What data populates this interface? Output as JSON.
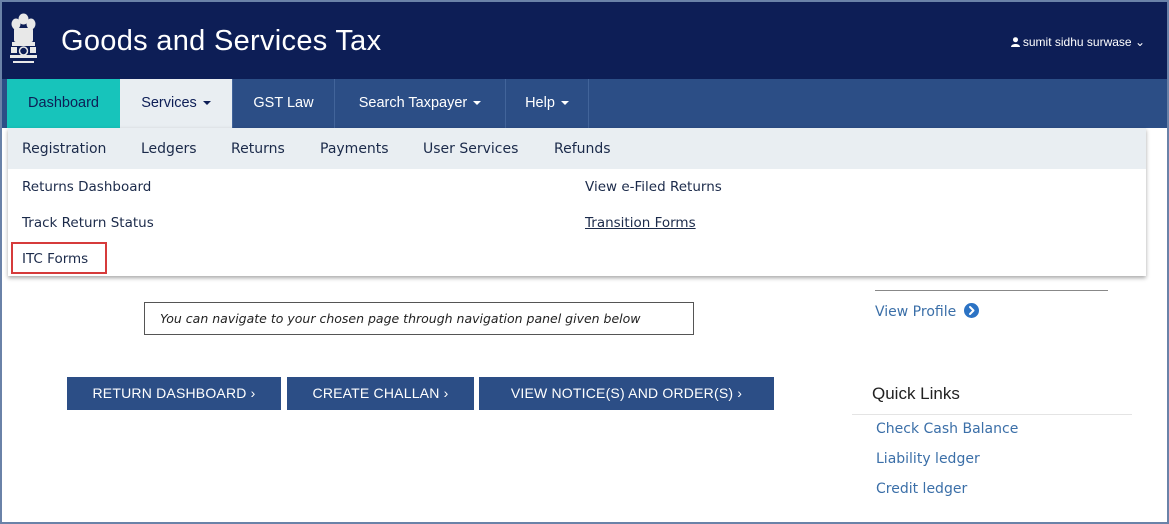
{
  "header": {
    "title": "Goods and Services Tax",
    "user_name": "sumit sidhu surwase",
    "user_caret": "⌄"
  },
  "nav": {
    "items": [
      {
        "label": "Dashboard"
      },
      {
        "label": "Services"
      },
      {
        "label": "GST Law"
      },
      {
        "label": "Search Taxpayer"
      },
      {
        "label": "Help"
      }
    ]
  },
  "services_menu": {
    "tabs": [
      "Registration",
      "Ledgers",
      "Returns",
      "Payments",
      "User Services",
      "Refunds"
    ],
    "links_left": [
      "Returns Dashboard",
      "Track Return Status",
      "ITC Forms"
    ],
    "links_right": [
      "View e-Filed Returns",
      "Transition Forms"
    ]
  },
  "main": {
    "info_text": "You can navigate to your chosen page through navigation panel given below",
    "buttons": [
      "RETURN DASHBOARD ›",
      "CREATE CHALLAN ›",
      "VIEW NOTICE(S) AND ORDER(S) ›"
    ]
  },
  "sidebar": {
    "view_profile": "View Profile",
    "quick_links_title": "Quick Links",
    "quick_links": [
      "Check Cash Balance",
      "Liability ledger",
      "Credit ledger"
    ]
  },
  "colors": {
    "header_bg": "#0d1e56",
    "nav_bg": "#2c4e86",
    "nav_active": "#17c4bb",
    "highlight_border": "#d63b3b",
    "link": "#3b6fa8"
  }
}
